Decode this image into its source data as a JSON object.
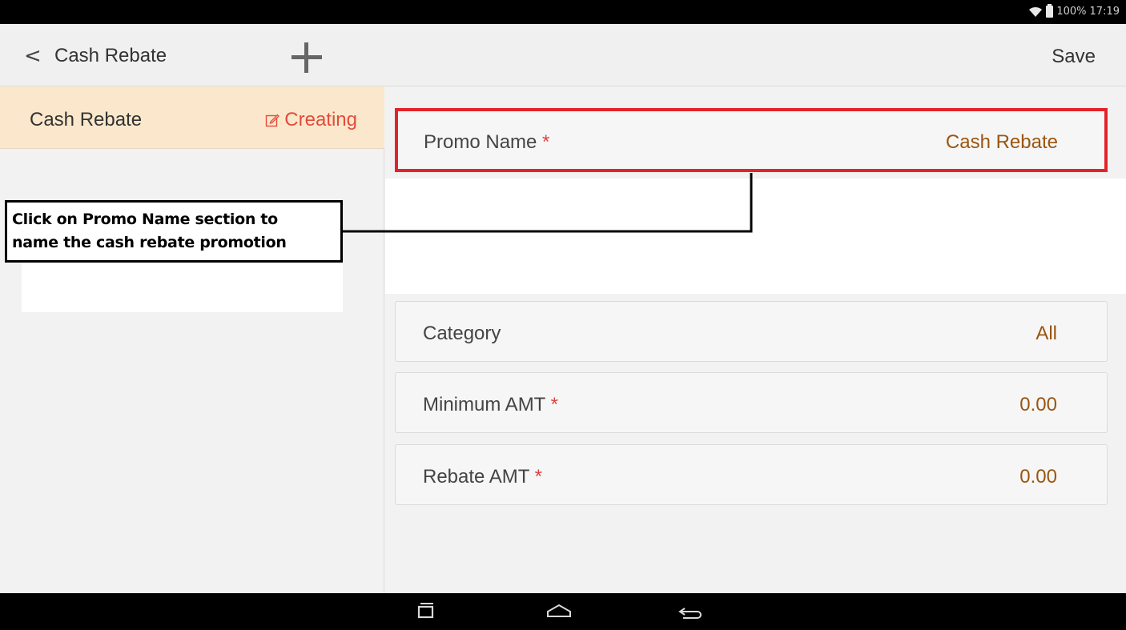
{
  "status_bar": {
    "battery": "100%",
    "time": "17:19"
  },
  "toolbar": {
    "back_label": "Cash Rebate",
    "save_label": "Save"
  },
  "sidebar": {
    "items": [
      {
        "label": "Cash Rebate",
        "status": "Creating"
      }
    ]
  },
  "form": {
    "required_marker": "*",
    "fields": [
      {
        "label": "Promo Name",
        "required": true,
        "value": "Cash Rebate"
      },
      {
        "label": "Category",
        "required": false,
        "value": "All"
      },
      {
        "label": "Minimum AMT",
        "required": true,
        "value": "0.00"
      },
      {
        "label": "Rebate AMT",
        "required": true,
        "value": "0.00"
      }
    ]
  },
  "annotation": {
    "line1": "Click on Promo Name section to",
    "line2": "name the cash rebate promotion"
  },
  "colors": {
    "highlight": "#e3222b",
    "value_text": "#9a5510",
    "status_text": "#e44b3c",
    "active_item_bg": "#fbe8cc"
  },
  "icons": {
    "back": "chevron-left-icon",
    "add": "plus-icon",
    "status": "edit-icon",
    "nav": [
      "recent-apps-icon",
      "home-icon",
      "back-icon"
    ]
  }
}
